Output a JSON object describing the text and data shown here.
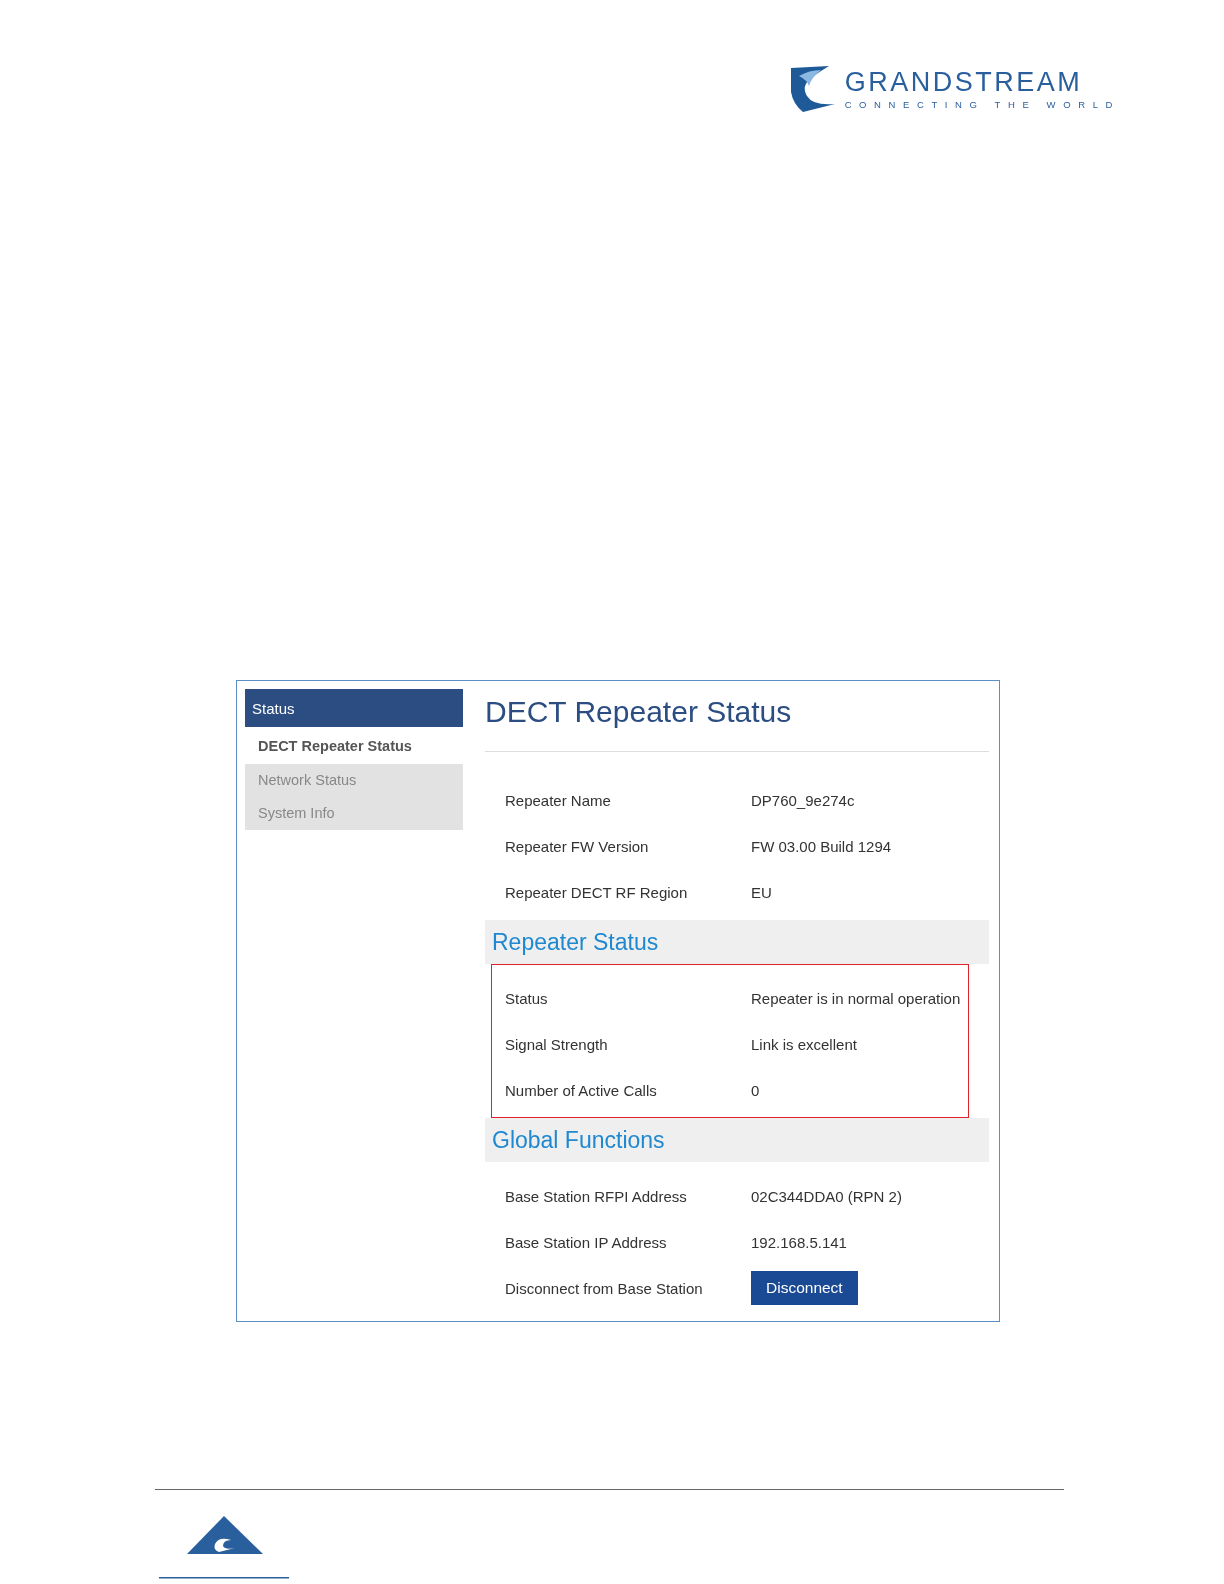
{
  "logo": {
    "name": "GRANDSTREAM",
    "tagline": "CONNECTING THE WORLD"
  },
  "sidebar": {
    "header": "Status",
    "items": [
      {
        "label": "DECT Repeater Status",
        "selected": true
      },
      {
        "label": "Network Status",
        "selected": false
      },
      {
        "label": "System Info",
        "selected": false
      }
    ]
  },
  "title": "DECT Repeater Status",
  "sections": [
    {
      "highlighted": false,
      "rows": [
        {
          "label": "Repeater Name",
          "value": "DP760_9e274c",
          "kind": "text"
        },
        {
          "label": "Repeater FW Version",
          "value": "FW 03.00 Build 1294",
          "kind": "text"
        },
        {
          "label": "Repeater DECT RF Region",
          "value": "EU",
          "kind": "text"
        }
      ]
    },
    {
      "heading": "Repeater Status",
      "highlighted": true,
      "rows": [
        {
          "label": "Status",
          "value": "Repeater is in normal operation",
          "kind": "text"
        },
        {
          "label": "Signal Strength",
          "value": "Link is excellent",
          "kind": "text"
        },
        {
          "label": "Number of Active Calls",
          "value": "0",
          "kind": "text"
        }
      ]
    },
    {
      "heading": "Global Functions",
      "highlighted": false,
      "rows": [
        {
          "label": "Base Station RFPI Address",
          "value": "02C344DDA0 (RPN 2)",
          "kind": "text"
        },
        {
          "label": "Base Station IP Address",
          "value": "192.168.5.141",
          "kind": "text"
        },
        {
          "label": "Disconnect from Base Station",
          "value": "Disconnect",
          "kind": "button"
        }
      ]
    }
  ]
}
